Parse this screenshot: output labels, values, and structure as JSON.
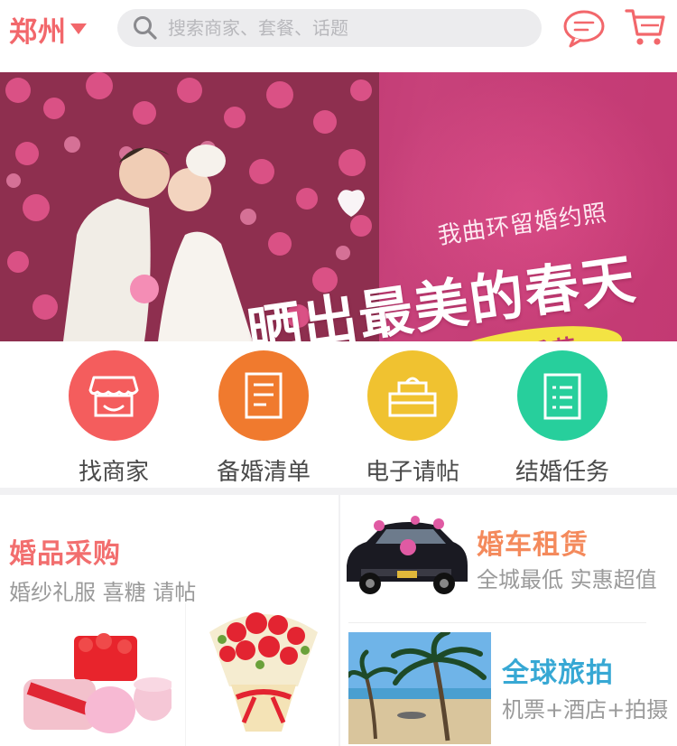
{
  "header": {
    "city": "郑州",
    "search_placeholder": "搜索商家、套餐、话题",
    "message_icon": "chat-bubble-icon",
    "cart_icon": "shopping-cart-icon",
    "accent_color": "#f2676b"
  },
  "banner": {
    "subtitle": "我曲环留婚约照",
    "headline": "晒出最美的春天",
    "tag": "美丽季节",
    "slide_count": 3,
    "active_slide": 1
  },
  "categories": [
    {
      "label": "找商家",
      "icon": "storefront-icon",
      "color": "#f45d5d"
    },
    {
      "label": "备婚清单",
      "icon": "checklist-icon",
      "color": "#f07a2e"
    },
    {
      "label": "电子请帖",
      "icon": "cake-icon",
      "color": "#f0c230"
    },
    {
      "label": "结婚任务",
      "icon": "task-list-icon",
      "color": "#27cf9c"
    }
  ],
  "promos": {
    "shopping": {
      "title": "婚品采购",
      "subtitle": "婚纱礼服 喜糖 请帖",
      "title_color": "#f26e6e"
    },
    "car_rental": {
      "title": "婚车租赁",
      "subtitle": "全城最低 实惠超值",
      "title_color": "#f48a5c"
    },
    "travel_photo": {
      "title": "全球旅拍",
      "subtitle": "机票+酒店+拍摄",
      "title_color": "#37a8d4"
    }
  }
}
